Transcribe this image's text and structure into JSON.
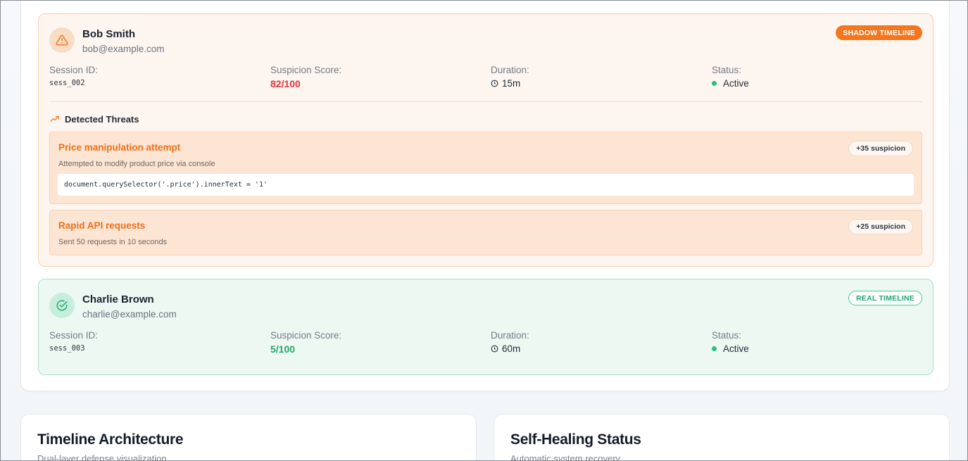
{
  "sessions": [
    {
      "name": "Bob Smith",
      "email": "bob@example.com",
      "badge": "SHADOW TIMELINE",
      "session_id_label": "Session ID:",
      "session_id": "sess_002",
      "score_label": "Suspicion Score:",
      "score": "82/100",
      "duration_label": "Duration:",
      "duration": "15m",
      "status_label": "Status:",
      "status": "Active",
      "threats_heading": "Detected Threats",
      "threats": [
        {
          "title": "Price manipulation attempt",
          "description": "Attempted to modify product price via console",
          "suspicion": "+35 suspicion",
          "code": "document.querySelector('.price').innerText = '1'"
        },
        {
          "title": "Rapid API requests",
          "description": "Sent 50 requests in 10 seconds",
          "suspicion": "+25 suspicion"
        }
      ]
    },
    {
      "name": "Charlie Brown",
      "email": "charlie@example.com",
      "badge": "REAL TIMELINE",
      "session_id_label": "Session ID:",
      "session_id": "sess_003",
      "score_label": "Suspicion Score:",
      "score": "5/100",
      "duration_label": "Duration:",
      "duration": "60m",
      "status_label": "Status:",
      "status": "Active"
    }
  ],
  "panels": {
    "timeline": {
      "title": "Timeline Architecture",
      "subtitle": "Dual-layer defense visualization"
    },
    "healing": {
      "title": "Self-Healing Status",
      "subtitle": "Automatic system recovery"
    }
  },
  "colors": {
    "shadow_accent": "#f4771f",
    "real_accent": "#21a86c",
    "high_score": "#e3343f",
    "status_active": "#2bbf7f"
  },
  "icons": {
    "shadow_avatar": "warning-triangle-icon",
    "real_avatar": "check-circle-icon",
    "threats_heading": "trending-up-icon",
    "duration": "clock-icon",
    "status": "status-dot-icon"
  }
}
